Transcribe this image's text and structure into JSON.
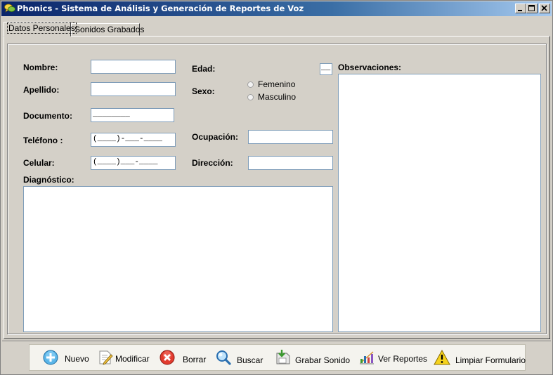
{
  "window": {
    "title": "Phonics - Sistema de Análisis y Generación de Reportes de Voz",
    "icon": "chat-bubbles-icon",
    "controls": {
      "minimize": "_",
      "maximize": "□",
      "close": "×"
    }
  },
  "tabs": [
    {
      "label": "Datos Personales",
      "active": true
    },
    {
      "label": "Sonidos Grabados",
      "active": false
    }
  ],
  "form": {
    "nombre": {
      "label": "Nombre:",
      "value": ""
    },
    "apellido": {
      "label": "Apellido:",
      "value": ""
    },
    "documento": {
      "label": "Documento:",
      "value": "________"
    },
    "telefono": {
      "label": "Teléfono :",
      "value": "(____)-___-____"
    },
    "celular": {
      "label": "Celular:",
      "value": "(____)___-____"
    },
    "edad": {
      "label": "Edad:",
      "value": "__"
    },
    "sexo": {
      "label": "Sexo:",
      "options": [
        "Femenino",
        "Masculino"
      ],
      "selected": null
    },
    "ocupacion": {
      "label": "Ocupación:",
      "value": ""
    },
    "direccion": {
      "label": "Dirección:",
      "value": ""
    },
    "diagnostico": {
      "label": "Diagnóstico:",
      "value": ""
    },
    "observaciones": {
      "label": "Observaciones:",
      "value": ""
    }
  },
  "toolbar": {
    "buttons": [
      {
        "label": "Nuevo",
        "icon": "add-icon"
      },
      {
        "label": "Modificar",
        "icon": "edit-icon"
      },
      {
        "label": "Borrar",
        "icon": "delete-icon"
      },
      {
        "label": "Buscar",
        "icon": "search-icon"
      },
      {
        "label": "Grabar Sonido",
        "icon": "record-icon"
      },
      {
        "label": "Ver Reportes",
        "icon": "reports-icon"
      },
      {
        "label": "Limpiar Formulario",
        "icon": "warning-icon"
      }
    ]
  },
  "colors": {
    "titlebar_start": "#0a246a",
    "titlebar_end": "#a6caf0",
    "background": "#d4d0c8",
    "toolbar_bg": "#f4f3ee"
  }
}
